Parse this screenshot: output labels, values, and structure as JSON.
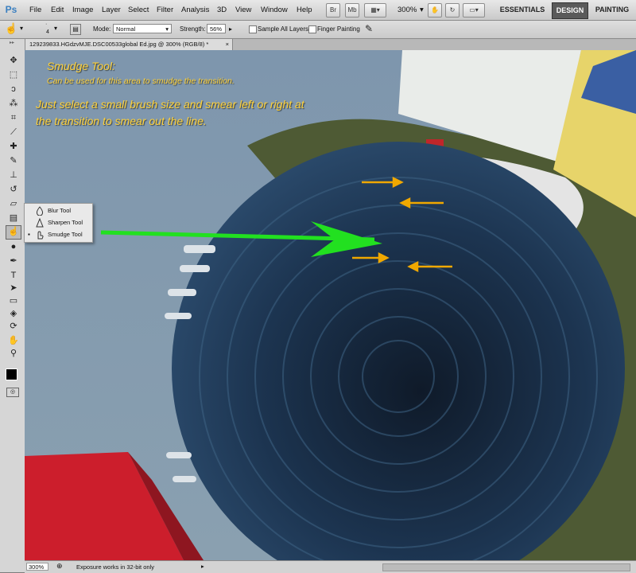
{
  "app": {
    "logo": "Ps"
  },
  "menu": [
    "File",
    "Edit",
    "Image",
    "Layer",
    "Select",
    "Filter",
    "Analysis",
    "3D",
    "View",
    "Window",
    "Help"
  ],
  "menubar_buttons": {
    "br": "Br",
    "mb": "Mb",
    "zoom": "300%"
  },
  "workspaces": [
    "ESSENTIALS",
    "DESIGN",
    "PAINTING"
  ],
  "options": {
    "brush_size": "4",
    "mode_label": "Mode:",
    "mode_value": "Normal",
    "strength_label": "Strength:",
    "strength_value": "56%",
    "sample_all_layers": "Sample All Layers",
    "finger_painting": "Finger Painting"
  },
  "document": {
    "tab_title": "129239833.HGdzvMJE.DSC00533global Ed.jpg @ 300% (RGB/8) *"
  },
  "flyout": {
    "items": [
      {
        "label": "Blur Tool",
        "icon": "blur-drop-icon"
      },
      {
        "label": "Sharpen Tool",
        "icon": "sharpen-triangle-icon"
      },
      {
        "label": "Smudge Tool",
        "icon": "smudge-finger-icon",
        "selected": true
      }
    ]
  },
  "annotations": {
    "title": "Smudge Tool:",
    "subtitle": "Can be used for this area to smudge the transition.",
    "line1": "Just select a small brush size and smear left or right at",
    "line2": "the transition to smear out the line."
  },
  "status": {
    "zoom": "300%",
    "text": "Exposure works in 32-bit only"
  },
  "colors": {
    "annotation": "#ffd23a",
    "arrow_green": "#22e020",
    "arrow_orange": "#f0a800",
    "sky": "#7f93a6",
    "water": "#1f3550"
  }
}
